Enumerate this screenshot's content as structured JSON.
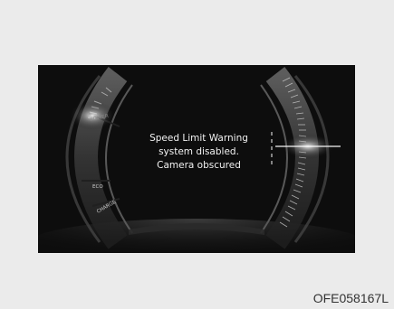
{
  "cluster": {
    "warning_lines": [
      "Speed Limit Warning",
      "system disabled.",
      "Camera obscured"
    ],
    "left_gauge_labels": {
      "power": "POWER",
      "eco": "ECO",
      "charge": "CHARGE"
    }
  },
  "image_code": "OFE058167L",
  "colors": {
    "background": "#ebebeb",
    "cluster_background": "#0d0d0d",
    "text": "#f2f2f2"
  }
}
